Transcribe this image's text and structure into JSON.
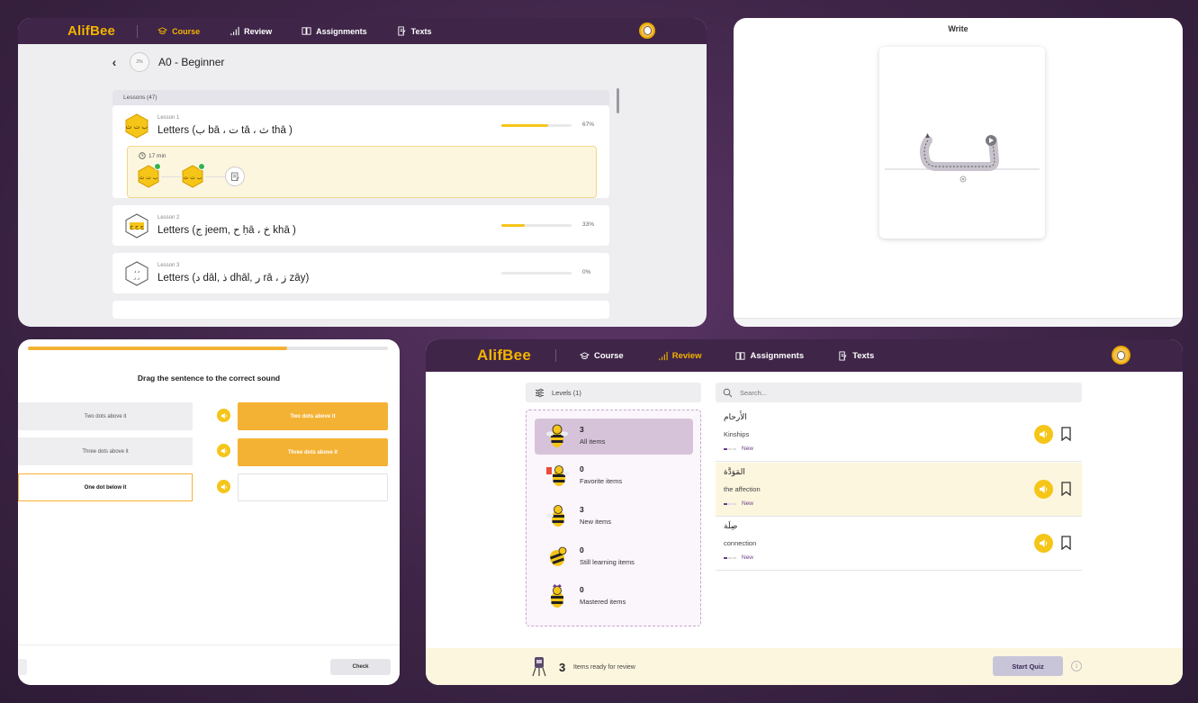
{
  "course_panel": {
    "app_logo": "AlifBee",
    "nav": [
      {
        "label": "Course",
        "icon": "graduation-cap-icon",
        "active": true
      },
      {
        "label": "Review",
        "icon": "bar-chart-icon",
        "active": false
      },
      {
        "label": "Assignments",
        "icon": "book-open-icon",
        "active": false
      },
      {
        "label": "Texts",
        "icon": "document-edit-icon",
        "active": false
      }
    ],
    "level_progress": "2%",
    "level_title": "A0 - Beginner",
    "lessons_header": "Lessons (47)",
    "lessons": [
      {
        "number_label": "Lesson 1",
        "title": "Letters (ب bā ، ت tā ، ث thā )",
        "progress_text": "67%",
        "progress": 0.67,
        "duration": "17 min"
      },
      {
        "number_label": "Lesson 2",
        "title": "Letters (ج jeem, ح ḥā ، خ khā )",
        "progress_text": "33%",
        "progress": 0.33
      },
      {
        "number_label": "Lesson 3",
        "title": "Letters (د dāl, ذ dhāl, ر rā ، ز zāy)",
        "progress_text": "0%",
        "progress": 0
      }
    ]
  },
  "write_panel": {
    "title": "Write"
  },
  "drag_panel": {
    "progress": 0.72,
    "title": "Drag the sentence to the correct sound",
    "sources": [
      "Two dots above it",
      "Three dots above it",
      "One dot below it"
    ],
    "targets": [
      "Two dots above it",
      "Three dots above it",
      ""
    ],
    "check_label": "Check"
  },
  "review_panel": {
    "app_logo": "AlifBee",
    "nav": [
      {
        "label": "Course",
        "icon": "graduation-cap-icon",
        "active": false
      },
      {
        "label": "Review",
        "icon": "bar-chart-icon",
        "active": true
      },
      {
        "label": "Assignments",
        "icon": "book-open-icon",
        "active": false
      },
      {
        "label": "Texts",
        "icon": "document-edit-icon",
        "active": false
      }
    ],
    "levels_label": "Levels (1)",
    "search_placeholder": "Search...",
    "levels": [
      {
        "count": "3",
        "label": "All items",
        "active": true
      },
      {
        "count": "0",
        "label": "Favorite items",
        "active": false
      },
      {
        "count": "3",
        "label": "New items",
        "active": false
      },
      {
        "count": "0",
        "label": "Still learning items",
        "active": false
      },
      {
        "count": "0",
        "label": "Mastered items",
        "active": false
      }
    ],
    "words": [
      {
        "arabic": "الأَرحام",
        "english": "Kinships",
        "status": "New",
        "highlighted": false
      },
      {
        "arabic": "المَوَدَّة",
        "english": "the affection",
        "status": "New",
        "highlighted": true
      },
      {
        "arabic": "صِلَة",
        "english": "connection",
        "status": "New",
        "highlighted": false
      }
    ],
    "footer": {
      "ready_count": "3",
      "ready_text": "Items ready for review",
      "start_quiz_label": "Start Quiz"
    }
  },
  "colors": {
    "topbar": "#3f2548",
    "accent_yellow": "#f5c518",
    "accent_orange": "#f4b234",
    "brand_purple": "#6a3f86"
  }
}
